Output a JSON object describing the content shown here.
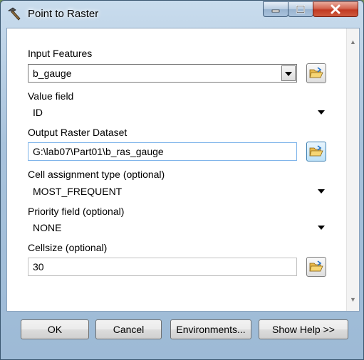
{
  "window": {
    "title": "Point to Raster",
    "minimize_glyph": "—",
    "maximize_glyph": "□",
    "close_glyph": "✕",
    "icon": "hammer-icon"
  },
  "form": {
    "input_features": {
      "label": "Input Features",
      "value": "b_gauge"
    },
    "value_field": {
      "label": "Value field",
      "value": "ID"
    },
    "output_raster": {
      "label": "Output Raster Dataset",
      "value": "G:\\lab07\\Part01\\b_ras_gauge"
    },
    "cell_assignment": {
      "label": "Cell assignment type (optional)",
      "value": "MOST_FREQUENT"
    },
    "priority_field": {
      "label": "Priority field (optional)",
      "value": "NONE"
    },
    "cellsize": {
      "label": "Cellsize (optional)",
      "value": "30"
    }
  },
  "buttons": {
    "ok": "OK",
    "cancel": "Cancel",
    "environments": "Environments...",
    "show_help": "Show Help >>"
  },
  "icons": [
    "hammer-icon",
    "folder-open-icon",
    "chevron-down-icon"
  ],
  "colors": {
    "frame": "#9dbad6",
    "close_button": "#c13a22",
    "focus_border": "#7eb4ea"
  }
}
